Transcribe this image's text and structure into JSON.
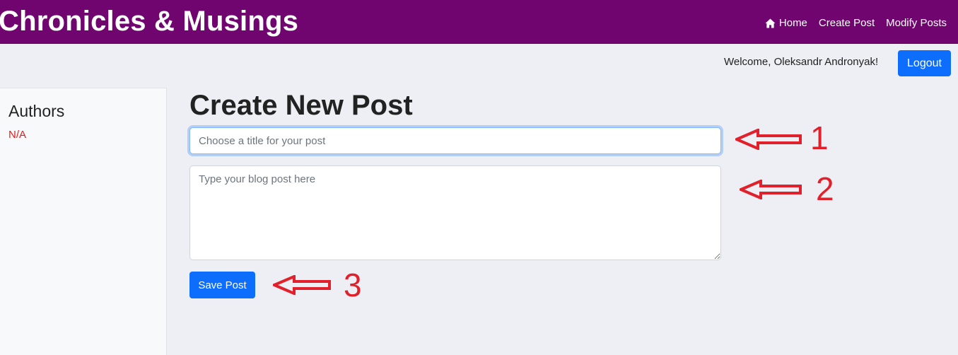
{
  "brand": {
    "title": "Chronicles & Musings"
  },
  "nav": {
    "home": {
      "label": "Home",
      "icon": "home-icon"
    },
    "create": {
      "label": "Create Post"
    },
    "modify": {
      "label": "Modify Posts"
    }
  },
  "user": {
    "welcome_text": "Welcome, Oleksandr Andronyak!",
    "logout_label": "Logout"
  },
  "sidebar": {
    "title": "Authors",
    "empty_text": "N/A"
  },
  "main": {
    "heading": "Create New Post",
    "title_placeholder": "Choose a title for your post",
    "title_value": "",
    "body_placeholder": "Type your blog post here",
    "body_value": "",
    "save_label": "Save Post"
  },
  "annotations": {
    "marker_1": "1",
    "marker_2": "2",
    "marker_3": "3",
    "color": "#e0202a"
  },
  "colors": {
    "navbar": "#700570",
    "primary": "#0d6efd",
    "background": "#edeff4",
    "error_text": "#e21b1b"
  }
}
